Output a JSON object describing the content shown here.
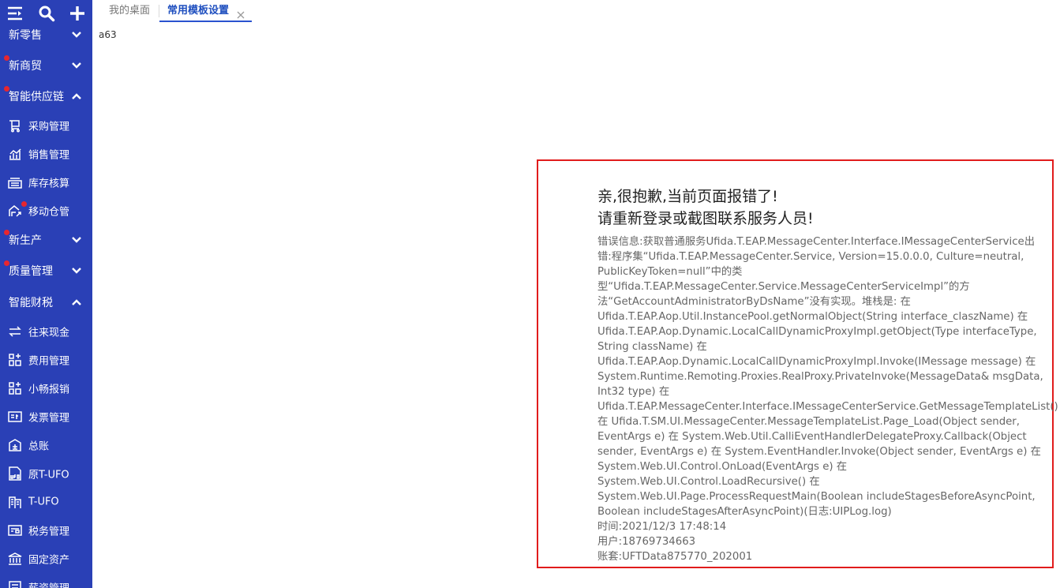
{
  "sidebar": {
    "toolbar": {
      "menu_icon": "menu-collapse-icon",
      "search_icon": "search-icon",
      "add_icon": "plus-icon"
    },
    "groups": [
      {
        "label": "新零售",
        "expanded": false,
        "badge": false
      },
      {
        "label": "新商贸",
        "expanded": false,
        "badge": true
      },
      {
        "label": "智能供应链",
        "expanded": true,
        "badge": true
      },
      {
        "label": "新生产",
        "expanded": false,
        "badge": true
      },
      {
        "label": "质量管理",
        "expanded": false,
        "badge": true
      },
      {
        "label": "智能财税",
        "expanded": true,
        "badge": false
      }
    ],
    "supply_items": [
      {
        "label": "采购管理",
        "icon": "purchase-cart-icon"
      },
      {
        "label": "销售管理",
        "icon": "sales-chart-icon"
      },
      {
        "label": "库存核算",
        "icon": "inventory-icon"
      },
      {
        "label": "移动仓管",
        "icon": "mobile-warehouse-icon",
        "badge": true
      }
    ],
    "finance_items": [
      {
        "label": "往来现金",
        "icon": "cash-exchange-icon"
      },
      {
        "label": "费用管理",
        "icon": "expense-icon"
      },
      {
        "label": "小畅报销",
        "icon": "reimburse-icon"
      },
      {
        "label": "发票管理",
        "icon": "invoice-icon"
      },
      {
        "label": "总账",
        "icon": "ledger-icon"
      },
      {
        "label": "原T-UFO",
        "icon": "ufo-icon"
      },
      {
        "label": "T-UFO",
        "icon": "building-icon"
      },
      {
        "label": "税务管理",
        "icon": "tax-icon"
      },
      {
        "label": "固定资产",
        "icon": "bank-icon"
      },
      {
        "label": "薪资管理",
        "icon": "salary-icon"
      }
    ],
    "colors": {
      "background": "#2a40b6",
      "badge": "#e7262f"
    }
  },
  "tabs": [
    {
      "label": "我的桌面",
      "active": false
    },
    {
      "label": "常用模板设置",
      "active": true
    }
  ],
  "content": {
    "code": "a63"
  },
  "error": {
    "title_lines": [
      "亲,很抱歉,当前页面报错了!",
      "请重新登录或截图联系服务人员!"
    ],
    "body_lines": [
      "错误信息:获取普通服务Ufida.T.EAP.MessageCenter.Interface.IMessageCenterService出",
      "错:程序集“Ufida.T.EAP.MessageCenter.Service, Version=15.0.0.0, Culture=neutral,",
      "PublicKeyToken=null”中的类",
      "型“Ufida.T.EAP.MessageCenter.Service.MessageCenterServiceImpl”的方",
      "法“GetAccountAdministratorByDsName”没有实现。堆栈是:   在",
      "Ufida.T.EAP.Aop.Util.InstancePool.getNormalObject(String interface_claszName) 在",
      "Ufida.T.EAP.Aop.Dynamic.LocalCallDynamicProxyImpl.getObject(Type interfaceType,",
      "String className) 在",
      "Ufida.T.EAP.Aop.Dynamic.LocalCallDynamicProxyImpl.Invoke(IMessage message) 在",
      "System.Runtime.Remoting.Proxies.RealProxy.PrivateInvoke(MessageData& msgData,",
      "Int32 type) 在",
      "Ufida.T.EAP.MessageCenter.Interface.IMessageCenterService.GetMessageTemplateList()",
      "在 Ufida.T.SM.UI.MessageCenter.MessageTemplateList.Page_Load(Object sender,",
      "EventArgs e) 在 System.Web.Util.CalliEventHandlerDelegateProxy.Callback(Object",
      "sender, EventArgs e) 在 System.EventHandler.Invoke(Object sender, EventArgs e) 在",
      "System.Web.UI.Control.OnLoad(EventArgs e) 在",
      "System.Web.UI.Control.LoadRecursive() 在",
      "System.Web.UI.Page.ProcessRequestMain(Boolean includeStagesBeforeAsyncPoint,",
      "Boolean includeStagesAfterAsyncPoint)(日志:UIPLog.log)"
    ],
    "time": "时间:2021/12/3 17:48:14",
    "user": "用户:18769734663",
    "account": "账套:UFTData875770_202001",
    "border_color": "#e11c1c"
  }
}
